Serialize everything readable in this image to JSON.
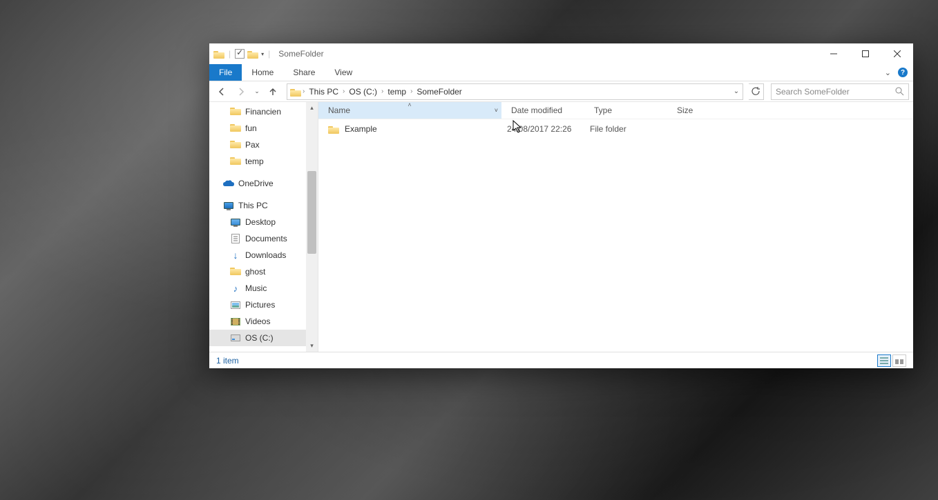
{
  "titlebar": {
    "title": "SomeFolder"
  },
  "ribbon": {
    "file": "File",
    "tabs": [
      "Home",
      "Share",
      "View"
    ]
  },
  "address": {
    "crumbs": [
      "This PC",
      "OS (C:)",
      "temp",
      "SomeFolder"
    ]
  },
  "search": {
    "placeholder": "Search SomeFolder"
  },
  "sidebar": {
    "top_items": [
      {
        "label": "Financien"
      },
      {
        "label": "fun"
      },
      {
        "label": "Pax"
      },
      {
        "label": "temp"
      }
    ],
    "onedrive": "OneDrive",
    "thispc": "This PC",
    "pc_items": [
      {
        "label": "Desktop"
      },
      {
        "label": "Documents"
      },
      {
        "label": "Downloads"
      },
      {
        "label": "ghost"
      },
      {
        "label": "Music"
      },
      {
        "label": "Pictures"
      },
      {
        "label": "Videos"
      },
      {
        "label": "OS (C:)"
      }
    ]
  },
  "columns": {
    "name": "Name",
    "date": "Date modified",
    "type": "Type",
    "size": "Size"
  },
  "rows": [
    {
      "name": "Example",
      "date": "24/08/2017 22:26",
      "type": "File folder",
      "size": ""
    }
  ],
  "status": {
    "count": "1 item"
  }
}
